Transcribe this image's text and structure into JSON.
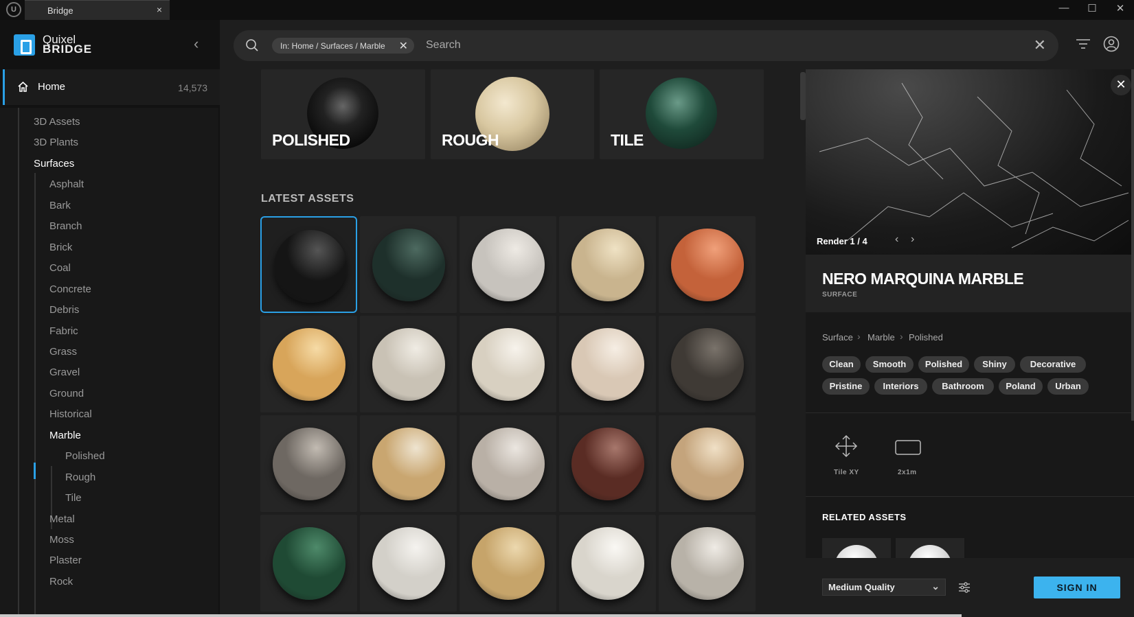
{
  "window": {
    "logo_text": "U",
    "tab_label": "Bridge",
    "tab_close": "×",
    "minimize": "—",
    "maximize": "☐",
    "close": "✕"
  },
  "brand": {
    "line1": "Quixel",
    "line2": "BRIDGE",
    "collapse_glyph": "‹"
  },
  "nav": {
    "home_label": "Home",
    "home_count": "14,573",
    "tree": [
      {
        "label": "3D Assets",
        "level": 1
      },
      {
        "label": "3D Plants",
        "level": 1
      },
      {
        "label": "Surfaces",
        "level": 1,
        "active": true
      },
      {
        "label": "Asphalt",
        "level": 2
      },
      {
        "label": "Bark",
        "level": 2
      },
      {
        "label": "Branch",
        "level": 2
      },
      {
        "label": "Brick",
        "level": 2
      },
      {
        "label": "Coal",
        "level": 2
      },
      {
        "label": "Concrete",
        "level": 2
      },
      {
        "label": "Debris",
        "level": 2
      },
      {
        "label": "Fabric",
        "level": 2
      },
      {
        "label": "Grass",
        "level": 2
      },
      {
        "label": "Gravel",
        "level": 2
      },
      {
        "label": "Ground",
        "level": 2
      },
      {
        "label": "Historical",
        "level": 2
      },
      {
        "label": "Marble",
        "level": 2,
        "active": true
      },
      {
        "label": "Polished",
        "level": 3
      },
      {
        "label": "Rough",
        "level": 3
      },
      {
        "label": "Tile",
        "level": 3
      },
      {
        "label": "Metal",
        "level": 2
      },
      {
        "label": "Moss",
        "level": 2
      },
      {
        "label": "Plaster",
        "level": 2
      },
      {
        "label": "Rock",
        "level": 2
      }
    ]
  },
  "search": {
    "chip_label": "In: Home / Surfaces / Marble",
    "chip_remove": "✕",
    "placeholder": "Search",
    "clear_glyph": "✕"
  },
  "categories": [
    {
      "label": "POLISHED",
      "color": "#1a1a1a"
    },
    {
      "label": "ROUGH",
      "color": "#d8c7a0"
    },
    {
      "label": "TILE",
      "color": "#1f4a3a"
    }
  ],
  "latest": {
    "title": "LATEST ASSETS",
    "tiles": [
      {
        "color": "#151515",
        "hi": "#555",
        "selected": true
      },
      {
        "color": "#1e302b",
        "hi": "#4d6a60"
      },
      {
        "color": "#c7c3bd",
        "hi": "#eeeae4"
      },
      {
        "color": "#c9b48e",
        "hi": "#efe2c4"
      },
      {
        "color": "#c4623a",
        "hi": "#f0a07a"
      },
      {
        "color": "#d8a55a",
        "hi": "#f6dba6"
      },
      {
        "color": "#c9c2b5",
        "hi": "#f0ece4"
      },
      {
        "color": "#d8d0c1",
        "hi": "#f7f3ec"
      },
      {
        "color": "#d9c8b5",
        "hi": "#f6eee4"
      },
      {
        "color": "#3f3a35",
        "hi": "#7a736b"
      },
      {
        "color": "#6e6862",
        "hi": "#c2bbb2"
      },
      {
        "color": "#c9a670",
        "hi": "#eee4d0"
      },
      {
        "color": "#b9b0a6",
        "hi": "#ebe6e0"
      },
      {
        "color": "#5a2c24",
        "hi": "#a7776c"
      },
      {
        "color": "#c4a47c",
        "hi": "#f0e0c6"
      },
      {
        "color": "#1f4a34",
        "hi": "#4e8a6a"
      },
      {
        "color": "#d3d0c9",
        "hi": "#f5f3ef"
      },
      {
        "color": "#c6a46a",
        "hi": "#ecd8ae"
      },
      {
        "color": "#d9d5cc",
        "hi": "#faf8f4"
      },
      {
        "color": "#b8b2a8",
        "hi": "#efebe5"
      }
    ]
  },
  "detail": {
    "close_glyph": "✕",
    "render_counter": "Render 1 / 4",
    "prev_glyph": "‹",
    "next_glyph": "›",
    "title": "NERO MARQUINA MARBLE",
    "type": "SURFACE",
    "breadcrumb": [
      "Surface",
      "Marble",
      "Polished"
    ],
    "breadcrumb_sep": "›",
    "tags_row1": [
      "Clean",
      "Smooth",
      "Polished",
      "Shiny",
      "Decorative"
    ],
    "tags_row2": [
      "Pristine",
      "Interiors",
      "Bathroom",
      "Poland",
      "Urban"
    ],
    "tile_label": "Tile XY",
    "size_label": "2x1m",
    "related_title": "RELATED ASSETS",
    "quality": "Medium Quality",
    "quality_chevron": "⌄",
    "signin": "SIGN IN"
  },
  "colors": {
    "accent": "#2aa0e6",
    "signin": "#3cb3ee"
  }
}
